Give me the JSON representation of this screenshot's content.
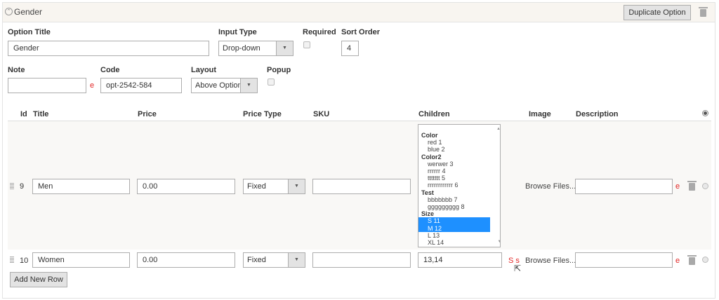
{
  "header": {
    "title": "Gender",
    "duplicate_label": "Duplicate Option"
  },
  "form": {
    "option_title": {
      "label": "Option Title",
      "value": "Gender"
    },
    "input_type": {
      "label": "Input Type",
      "value": "Drop-down"
    },
    "required": {
      "label": "Required",
      "checked": false
    },
    "sort_order": {
      "label": "Sort Order",
      "value": "4"
    },
    "note": {
      "label": "Note",
      "value": "",
      "suffix": "e"
    },
    "code": {
      "label": "Code",
      "value": "opt-2542-584"
    },
    "layout": {
      "label": "Layout",
      "value": "Above Option"
    },
    "popup": {
      "label": "Popup",
      "checked": false
    }
  },
  "columns": [
    "Id",
    "Title",
    "Price",
    "Price Type",
    "SKU",
    "Children",
    "Image",
    "Description"
  ],
  "rows": [
    {
      "id": "9",
      "title": "Men",
      "price": "0.00",
      "price_type": "Fixed",
      "sku": "",
      "image": "Browse Files...",
      "description": "",
      "desc_suffix": "e"
    },
    {
      "id": "10",
      "title": "Women",
      "price": "0.00",
      "price_type": "Fixed",
      "sku": "",
      "children": "13,14",
      "children_suffix": "S s",
      "image": "Browse Files...",
      "description": "",
      "desc_suffix": "e"
    }
  ],
  "children_list": [
    {
      "group": "Color",
      "options": [
        "red 1",
        "blue 2"
      ]
    },
    {
      "group": "Color2",
      "options": [
        "werwer 3",
        "rrrrrr 4",
        "ttttttt 5",
        "rrrrrrrrrrrr 6"
      ]
    },
    {
      "group": "Test",
      "options": [
        "bbbbbbb 7",
        "ggggggggg 8"
      ]
    },
    {
      "group": "Size",
      "options": [
        "S 11",
        "M 12",
        "L 13",
        "XL 14"
      ],
      "selected": [
        "S 11",
        "M 12"
      ]
    }
  ],
  "add_row_label": "Add New Row",
  "colors": {
    "accent_selected": "#1e90ff",
    "error": "#e22626",
    "header_bg": "#f8f5f0"
  }
}
